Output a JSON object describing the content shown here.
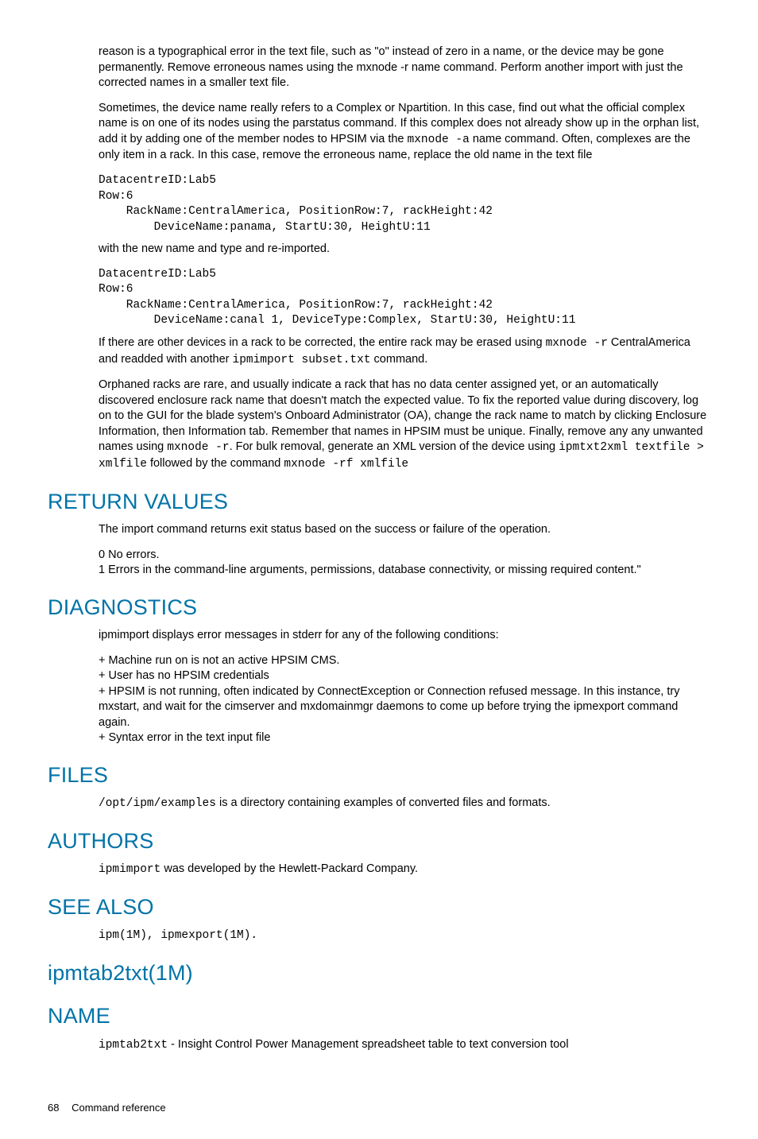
{
  "intro": {
    "p1a": "reason is a typographical error in the text file, such as \"o\" instead of zero in a name, or the device may be gone permanently. Remove erroneous names using the mxnode -r name command. Perform another import with just the corrected names in a smaller text file.",
    "p2a": "Sometimes, the device name really refers to a Complex or Npartition. In this case, find out what the official complex name is on one of its nodes using the parstatus command. If this complex does not already show up in the orphan list, add it by adding one of the member nodes to HPSIM via the ",
    "p2code": "mxnode -a",
    "p2b": " name command. Often, complexes are the only item in a rack. In this case, remove the erroneous name, replace the old name in the text file",
    "pre1": "DatacentreID:Lab5\nRow:6\n    RackName:CentralAmerica, PositionRow:7, rackHeight:42\n        DeviceName:panama, StartU:30, HeightU:11",
    "p3": "with the new name and type and re-imported.",
    "pre2": "DatacentreID:Lab5\nRow:6\n    RackName:CentralAmerica, PositionRow:7, rackHeight:42\n        DeviceName:canal 1, DeviceType:Complex, StartU:30, HeightU:11",
    "p4a": "If there are other devices in a rack to be corrected, the entire rack may be erased using ",
    "p4code1": "mxnode -r",
    "p4b": " CentralAmerica and readded with another ",
    "p4code2": "ipmimport subset.txt",
    "p4c": " command.",
    "p5a": "Orphaned racks are rare, and usually indicate a rack that has no data center assigned yet, or an automatically discovered enclosure rack name that doesn't match the expected value. To fix the reported value during discovery, log on to the GUI for the blade system's Onboard Administrator (OA), change the rack name to match by clicking Enclosure Information, then Information tab. Remember that names in HPSIM must be unique. Finally, remove any any unwanted names using ",
    "p5code1": "mxnode -r",
    "p5b": ". For bulk removal, generate an XML version of the device using ",
    "p5code2": "ipmtxt2xml textfile > xmlfile",
    "p5c": " followed by the command ",
    "p5code3": "mxnode -rf xmlfile"
  },
  "return_values": {
    "heading": "RETURN VALUES",
    "p1": "The import command returns exit status based on the success or failure of the operation.",
    "r0": "0   No errors.",
    "r1": "1   Errors in the command-line arguments, permissions, database connectivity, or missing required content.\""
  },
  "diagnostics": {
    "heading": "DIAGNOSTICS",
    "p1": "ipmimport displays error messages in stderr for any of the following conditions:",
    "b1": "+   Machine run on is not an active HPSIM CMS.",
    "b2": "+   User has no HPSIM credentials",
    "b3": "+   HPSIM is not running, often indicated by ConnectException or Connection refused message. In this instance, try mxstart, and wait for the cimserver and mxdomainmgr daemons to come up before trying the ipmexport command again.",
    "b4": "+   Syntax error in the text input file"
  },
  "files": {
    "heading": "FILES",
    "code": "/opt/ipm/examples",
    "text": " is a directory containing examples of converted files and formats."
  },
  "authors": {
    "heading": "AUTHORS",
    "code": "ipmimport",
    "text": " was developed by the Hewlett-Packard Company."
  },
  "see_also": {
    "heading": "SEE ALSO",
    "text": "ipm(1M), ipmexport(1M)."
  },
  "ipmtab2txt": {
    "heading": "ipmtab2txt(1M)"
  },
  "name": {
    "heading": "NAME",
    "code": "ipmtab2txt",
    "text": " - Insight Control Power Management spreadsheet table to text conversion tool"
  },
  "footer": {
    "page": "68",
    "title": "Command reference"
  }
}
